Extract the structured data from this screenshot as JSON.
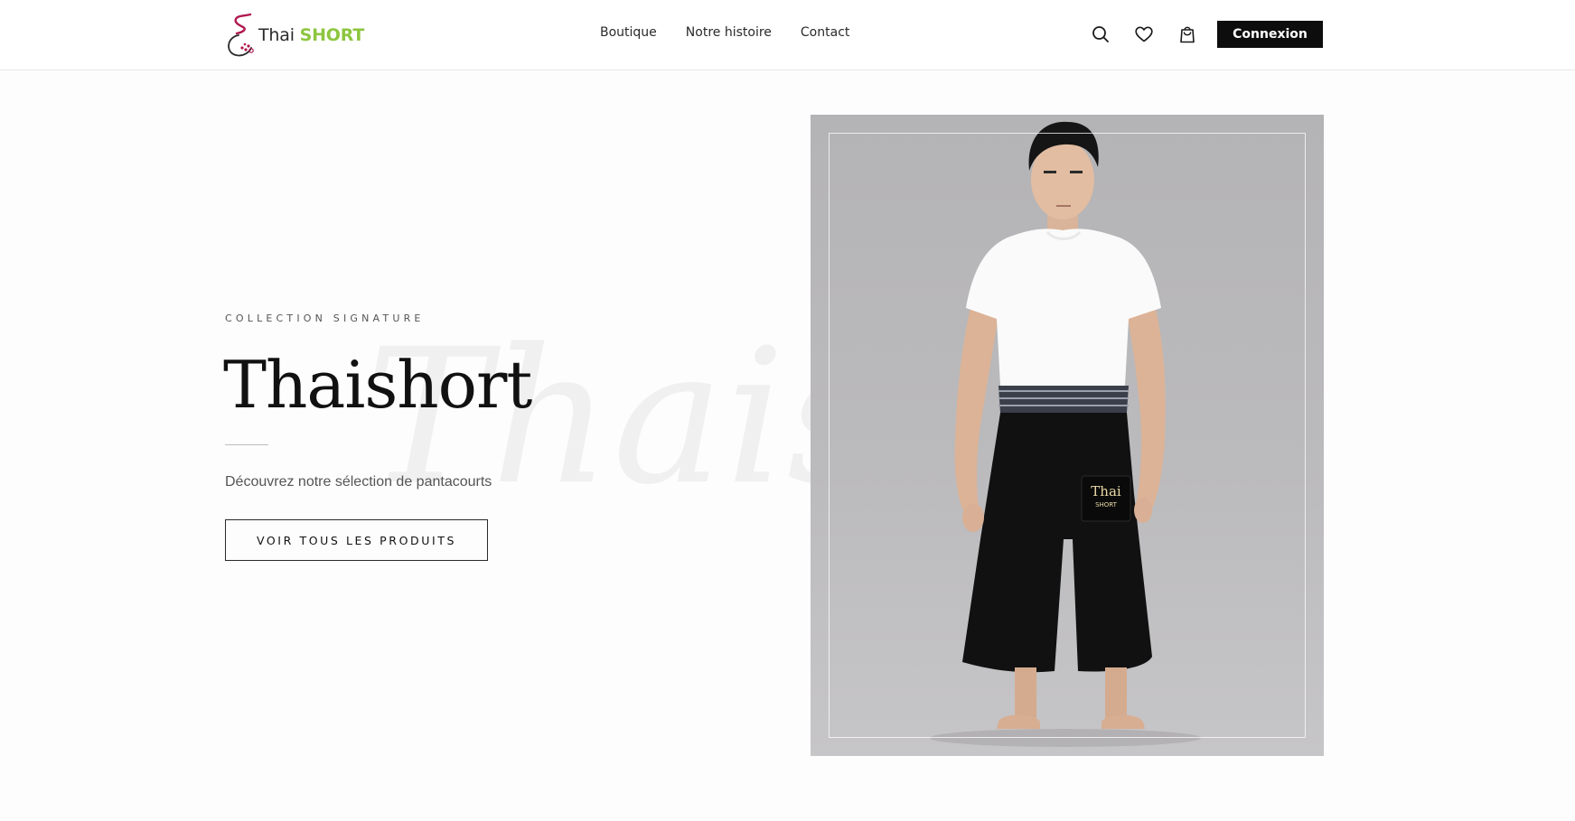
{
  "brand": {
    "logo_part1": "Thai",
    "logo_part2": "SHORT",
    "accent_color": "#8dc63f",
    "logo_mark_color": "#b0174f"
  },
  "nav": {
    "items": [
      {
        "label": "Boutique"
      },
      {
        "label": "Notre histoire"
      },
      {
        "label": "Contact"
      }
    ]
  },
  "header_actions": {
    "icons": [
      "search-icon",
      "heart-icon",
      "cart-icon"
    ],
    "login_label": "Connexion"
  },
  "hero": {
    "eyebrow": "COLLECTION SIGNATURE",
    "title": "Thaishort",
    "watermark": "Thais",
    "subtitle": "Découvrez notre sélection de pantacourts",
    "cta_label": "VOIR TOUS LES PRODUITS"
  },
  "product_image": {
    "patch_line1": "Thai",
    "patch_line2": "SHORT"
  }
}
